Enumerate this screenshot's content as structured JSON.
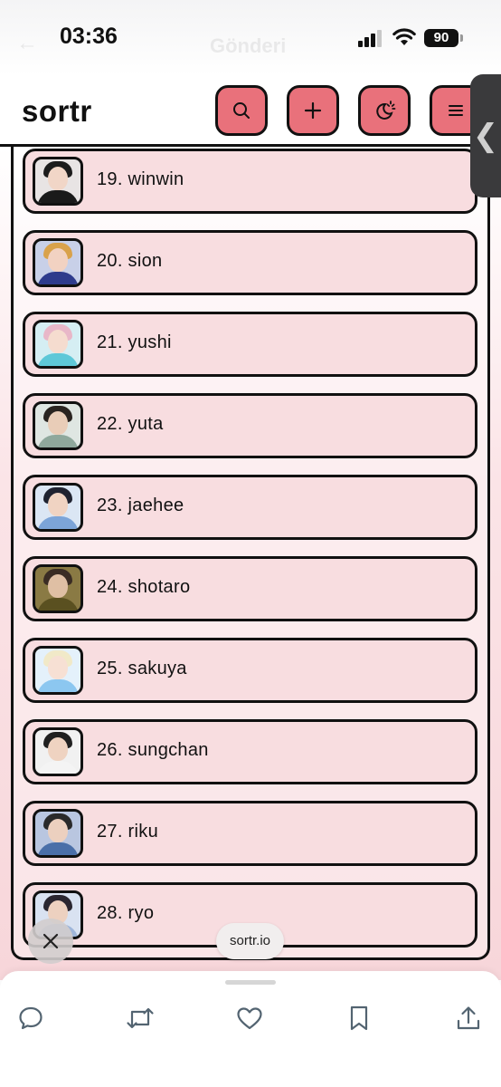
{
  "status_bar": {
    "time": "03:36",
    "battery": "90",
    "faded_title": "Gönderi"
  },
  "header": {
    "logo": "sortr"
  },
  "toolbar": {
    "search_icon": "search-icon",
    "add_icon": "plus-icon",
    "theme_icon": "moon-sun-icon",
    "menu_icon": "menu-icon"
  },
  "colors": {
    "accent": "#e9717b",
    "item_bg": "#f8dde0",
    "border": "#111111"
  },
  "ranking": [
    {
      "label": "19.  winwin",
      "hair": "#1c1c1c",
      "skin": "#f1d6c7",
      "shirt": "#1a1a1a",
      "bg": "#e8e4e4"
    },
    {
      "label": "20.  sion",
      "hair": "#d9a24b",
      "skin": "#f2d2c2",
      "shirt": "#2e3b8c",
      "bg": "#c8d0e8"
    },
    {
      "label": "21.  yushi",
      "hair": "#e8b7c8",
      "skin": "#f5dccf",
      "shirt": "#5ec8d8",
      "bg": "#d5eef3"
    },
    {
      "label": "22.  yuta",
      "hair": "#2a2420",
      "skin": "#e9cdb8",
      "shirt": "#8fa89c",
      "bg": "#dfe6e2"
    },
    {
      "label": "23.  jaehee",
      "hair": "#1f2230",
      "skin": "#f0d3c2",
      "shirt": "#7ca4d8",
      "bg": "#dbe6f4"
    },
    {
      "label": "24.  shotaro",
      "hair": "#3a2c24",
      "skin": "#dfbfa4",
      "shirt": "#5a5020",
      "bg": "#8a7a44"
    },
    {
      "label": "25.  sakuya",
      "hair": "#f1e9c8",
      "skin": "#f7e0d4",
      "shirt": "#8cc7f0",
      "bg": "#e4f1fb"
    },
    {
      "label": "26.  sungchan",
      "hair": "#202020",
      "skin": "#efd3c1",
      "shirt": "#f4f4f4",
      "bg": "#f1f1f1"
    },
    {
      "label": "27.  riku",
      "hair": "#2a2a2a",
      "skin": "#ecd0bf",
      "shirt": "#4a6fa8",
      "bg": "#b9c6e0"
    },
    {
      "label": "28.  ryo",
      "hair": "#2a2630",
      "skin": "#edd1c0",
      "shirt": "#9fb6da",
      "bg": "#d9e2f1"
    }
  ],
  "overlay": {
    "url": "sortr.io",
    "close_icon": "close-icon"
  },
  "actions": [
    {
      "name": "reply-button",
      "icon": "comment-icon"
    },
    {
      "name": "repost-button",
      "icon": "repost-icon"
    },
    {
      "name": "like-button",
      "icon": "heart-icon"
    },
    {
      "name": "bookmark-button",
      "icon": "bookmark-icon"
    },
    {
      "name": "share-button",
      "icon": "share-icon"
    }
  ]
}
